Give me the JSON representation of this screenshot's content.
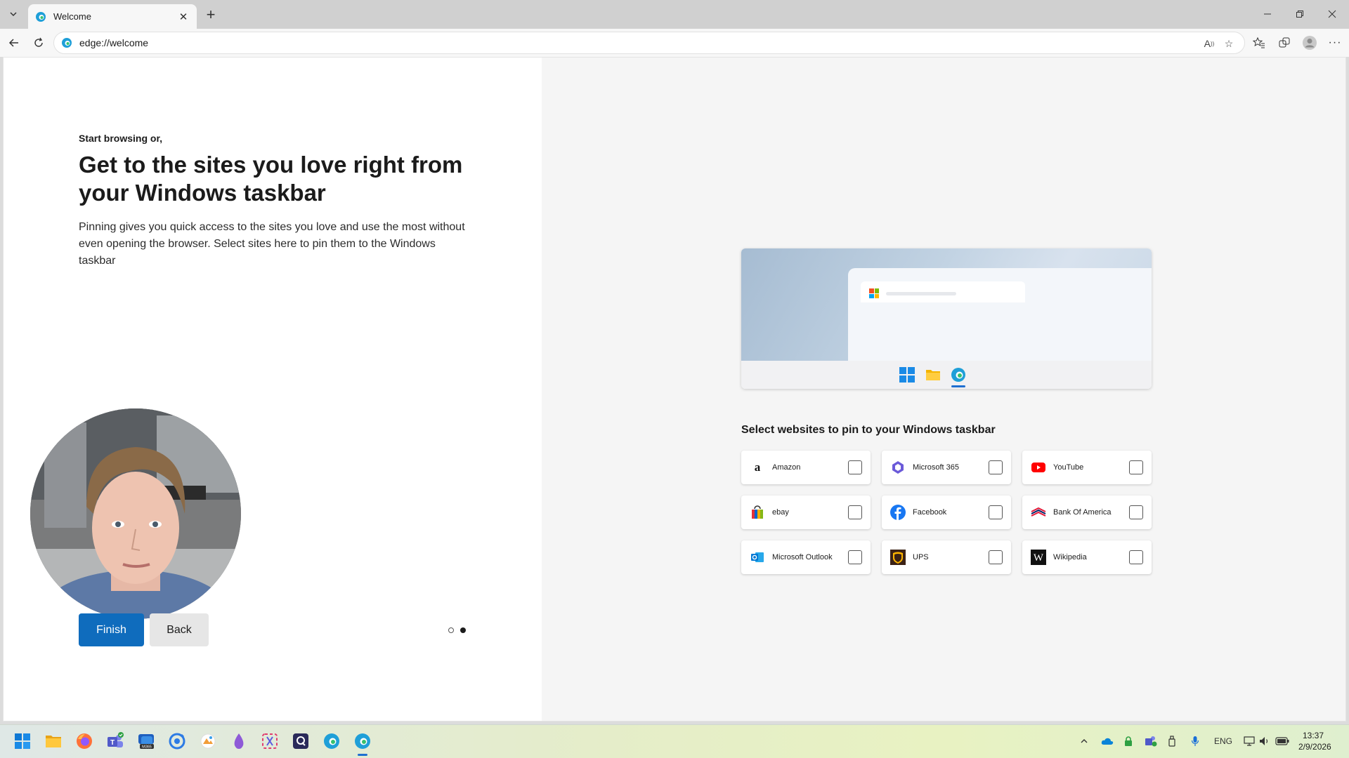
{
  "browser": {
    "tab_title": "Welcome",
    "address": "edge://welcome"
  },
  "welcome": {
    "eyebrow": "Start browsing or,",
    "headline": "Get to the sites you love right from your Windows taskbar",
    "description": "Pinning gives you quick access to the sites you love and use the most without even opening the browser. Select sites here to pin them to the Windows taskbar",
    "finish_label": "Finish",
    "back_label": "Back",
    "page_indicator": {
      "current": 2,
      "total": 2
    }
  },
  "pin_panel": {
    "title": "Select websites to pin to your Windows taskbar",
    "sites": [
      {
        "label": "Amazon",
        "icon": "amazon-icon",
        "checked": false
      },
      {
        "label": "Microsoft 365",
        "icon": "microsoft365-icon",
        "checked": false
      },
      {
        "label": "YouTube",
        "icon": "youtube-icon",
        "checked": false
      },
      {
        "label": "ebay",
        "icon": "ebay-icon",
        "checked": false
      },
      {
        "label": "Facebook",
        "icon": "facebook-icon",
        "checked": false
      },
      {
        "label": "Bank Of America",
        "icon": "bankofamerica-icon",
        "checked": false
      },
      {
        "label": "Microsoft Outlook",
        "icon": "outlook-icon",
        "checked": false
      },
      {
        "label": "UPS",
        "icon": "ups-icon",
        "checked": false
      },
      {
        "label": "Wikipedia",
        "icon": "wikipedia-icon",
        "checked": false
      }
    ]
  },
  "taskbar": {
    "language": "ENG",
    "time": "13:37",
    "date": "2/9/2026",
    "m365_badge": "M365"
  },
  "colors": {
    "accent": "#0f6cbd",
    "right_pane_bg": "#f5f5f5"
  }
}
